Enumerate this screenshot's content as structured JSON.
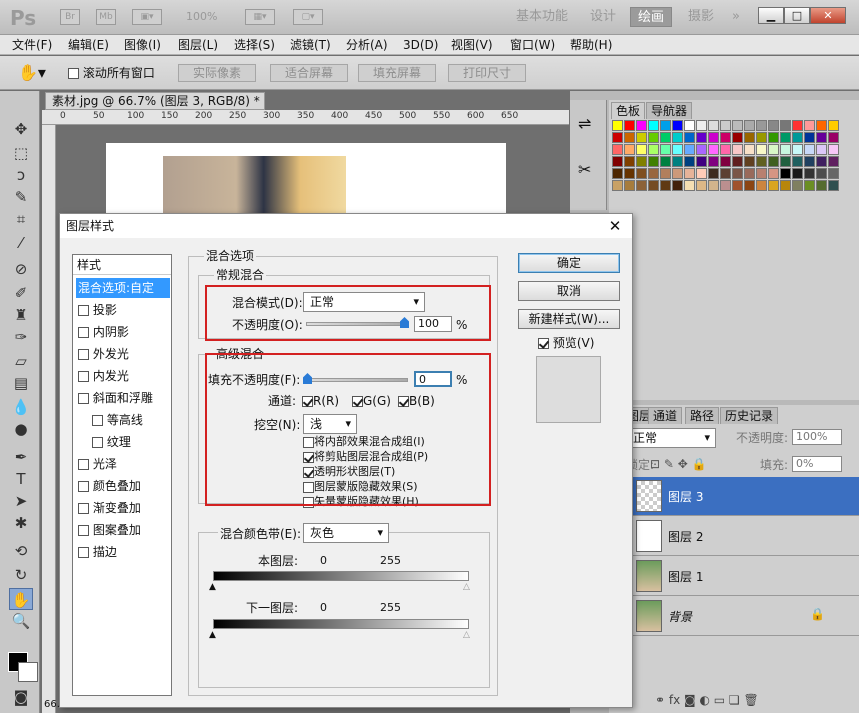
{
  "app": {
    "logo": "Ps",
    "mini_br": "Br",
    "mini_mb": "Mb",
    "zoom": "100%",
    "workspaces": [
      "基本功能",
      "设计",
      "绘画",
      "摄影"
    ],
    "more_glyph": "»"
  },
  "menu": [
    "文件(F)",
    "编辑(E)",
    "图像(I)",
    "图层(L)",
    "选择(S)",
    "滤镜(T)",
    "分析(A)",
    "3D(D)",
    "视图(V)",
    "窗口(W)",
    "帮助(H)"
  ],
  "options": {
    "scroll_all": "滚动所有窗口",
    "buttons": [
      "实际像素",
      "适合屏幕",
      "填充屏幕",
      "打印尺寸"
    ]
  },
  "document": {
    "tab": "素材.jpg @ 66.7% (图层 3, RGB/8) *",
    "ruler_ticks": [
      "0",
      "50",
      "100",
      "150",
      "200",
      "250",
      "300",
      "350",
      "400",
      "450",
      "500",
      "550",
      "600",
      "650"
    ],
    "status": "66."
  },
  "swatches_panel": {
    "tabs": [
      "色板",
      "导航器"
    ],
    "colors": [
      "#ffff00",
      "#ff0000",
      "#ff00ff",
      "#00ffff",
      "#00a0e9",
      "#0000ff",
      "#ffffff",
      "#eeeeee",
      "#dddddd",
      "#cccccc",
      "#bbbbbb",
      "#aaaaaa",
      "#999999",
      "#888888",
      "#777777",
      "#ff3333",
      "#ff9999",
      "#ff6600",
      "#ffcc00",
      "#cc0000",
      "#cc6600",
      "#cccc00",
      "#66cc00",
      "#00cc66",
      "#00cccc",
      "#0066cc",
      "#6600cc",
      "#cc00cc",
      "#cc0066",
      "#990000",
      "#996600",
      "#999900",
      "#339900",
      "#009966",
      "#009999",
      "#003399",
      "#660099",
      "#990066",
      "#ff6666",
      "#ffaa66",
      "#ffff66",
      "#aaff66",
      "#66ffaa",
      "#66ffff",
      "#66aaff",
      "#aa66ff",
      "#ff66ff",
      "#ff66aa",
      "#f7c7c7",
      "#f7e0c7",
      "#f7f7c7",
      "#d8f7c7",
      "#c7f7e0",
      "#c7f7f7",
      "#c7d8f7",
      "#dcc7f7",
      "#f7c7f7",
      "#800000",
      "#804000",
      "#808000",
      "#408000",
      "#008040",
      "#008080",
      "#004080",
      "#400080",
      "#800080",
      "#800040",
      "#602020",
      "#604020",
      "#606020",
      "#406020",
      "#206040",
      "#206060",
      "#204060",
      "#402060",
      "#602060",
      "#4d2600",
      "#663300",
      "#7f4f1f",
      "#99663d",
      "#b27f5c",
      "#cc997a",
      "#e6b399",
      "#ffccb8",
      "#3d2b1f",
      "#5c4033",
      "#7a5547",
      "#996a5b",
      "#b8806f",
      "#d69583",
      "#000000",
      "#1a1a1a",
      "#333333",
      "#4d4d4d",
      "#666666",
      "#c8a165",
      "#a67c3d",
      "#8c6239",
      "#754c24",
      "#603913",
      "#42210b",
      "#f5deb3",
      "#deb887",
      "#d2b48c",
      "#bc8f8f",
      "#a0522d",
      "#8b4513",
      "#cd853f",
      "#daa520",
      "#b8860b",
      "#808060",
      "#6b8e23",
      "#556b2f",
      "#2f4f4f"
    ]
  },
  "layers_panel": {
    "tabs": [
      "图层",
      "通道",
      "路径",
      "历史记录"
    ],
    "blend_mode": "正常",
    "opacity_label": "不透明度:",
    "opacity_value": "100%",
    "lock_label": "锁定:",
    "fill_label": "填充:",
    "fill_value": "0%",
    "layers": [
      {
        "name": "图层 3",
        "selected": true
      },
      {
        "name": "图层 2",
        "selected": false
      },
      {
        "name": "图层 1",
        "selected": false
      },
      {
        "name": "背景",
        "selected": false
      }
    ]
  },
  "dialog": {
    "title": "图层样式",
    "close": "✕",
    "style_list_header": "样式",
    "styles": [
      {
        "label": "混合选项:自定",
        "checkbox": false,
        "selected": true
      },
      {
        "label": "投影",
        "checkbox": true
      },
      {
        "label": "内阴影",
        "checkbox": true
      },
      {
        "label": "外发光",
        "checkbox": true
      },
      {
        "label": "内发光",
        "checkbox": true
      },
      {
        "label": "斜面和浮雕",
        "checkbox": true
      },
      {
        "label": "等高线",
        "checkbox": true,
        "indent": true
      },
      {
        "label": "纹理",
        "checkbox": true,
        "indent": true
      },
      {
        "label": "光泽",
        "checkbox": true
      },
      {
        "label": "颜色叠加",
        "checkbox": true
      },
      {
        "label": "渐变叠加",
        "checkbox": true
      },
      {
        "label": "图案叠加",
        "checkbox": true
      },
      {
        "label": "描边",
        "checkbox": true
      }
    ],
    "blend_options_title": "混合选项",
    "general": {
      "title": "常规混合",
      "blend_mode_label": "混合模式(D):",
      "blend_mode_value": "正常",
      "opacity_label": "不透明度(O):",
      "opacity_value": "100",
      "opacity_fraction": 1.0,
      "percent": "%"
    },
    "advanced": {
      "title": "高级混合",
      "fill_label": "填充不透明度(F):",
      "fill_value": "0",
      "fill_fraction": 0.0,
      "percent": "%",
      "channels_label": "通道:",
      "channels": [
        "R(R)",
        "G(G)",
        "B(B)"
      ],
      "knockout_label": "挖空(N):",
      "knockout_value": "浅",
      "checks": [
        {
          "label": "将内部效果混合成组(I)",
          "checked": false
        },
        {
          "label": "将剪贴图层混合成组(P)",
          "checked": true
        },
        {
          "label": "透明形状图层(T)",
          "checked": true
        },
        {
          "label": "图层蒙版隐藏效果(S)",
          "checked": false
        },
        {
          "label": "矢量蒙版隐藏效果(H)",
          "checked": false
        }
      ]
    },
    "blend_if": {
      "label": "混合颜色带(E):",
      "value": "灰色",
      "this_layer": "本图层:",
      "underlying": "下一图层:",
      "min": "0",
      "max": "255"
    },
    "buttons": {
      "ok": "确定",
      "cancel": "取消",
      "new_style": "新建样式(W)...",
      "preview": "预览(V)"
    }
  }
}
